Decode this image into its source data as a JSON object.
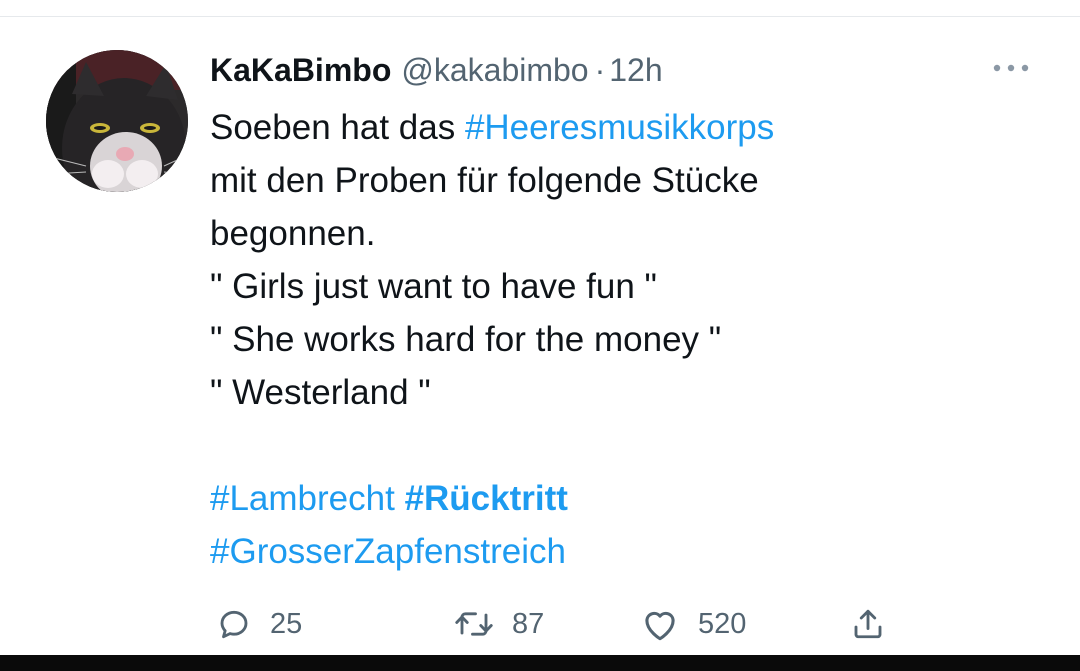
{
  "tweet": {
    "display_name": "KaKaBimbo",
    "handle": "@kakabimbo",
    "separator": "·",
    "time": "12h",
    "text_lines": [
      {
        "parts": [
          {
            "text": "Soeben hat das "
          },
          {
            "text": "#Heeresmusikkorps",
            "hashtag": true
          }
        ]
      },
      {
        "parts": [
          {
            "text": "mit den Proben für folgende Stücke"
          }
        ]
      },
      {
        "parts": [
          {
            "text": "begonnen."
          }
        ]
      },
      {
        "parts": [
          {
            "text": "\" Girls just want to have fun \""
          }
        ]
      },
      {
        "parts": [
          {
            "text": "\" She works hard for the money \""
          }
        ]
      },
      {
        "parts": [
          {
            "text": "\" Westerland \""
          }
        ]
      }
    ],
    "hashtag_lines": [
      [
        {
          "text": "#Lambrecht",
          "bold": false
        },
        {
          "text": "#Rücktritt",
          "bold": true
        }
      ],
      [
        {
          "text": "#GrosserZapfenstreich",
          "bold": false
        }
      ]
    ],
    "hashtag_color": "#1d9bf0"
  },
  "actions": {
    "reply_count": "25",
    "retweet_count": "87",
    "like_count": "520",
    "icons": [
      "reply-icon",
      "retweet-icon",
      "like-icon",
      "share-icon"
    ]
  },
  "icons": {
    "more": "more-icon",
    "avatar": "cat-avatar"
  }
}
